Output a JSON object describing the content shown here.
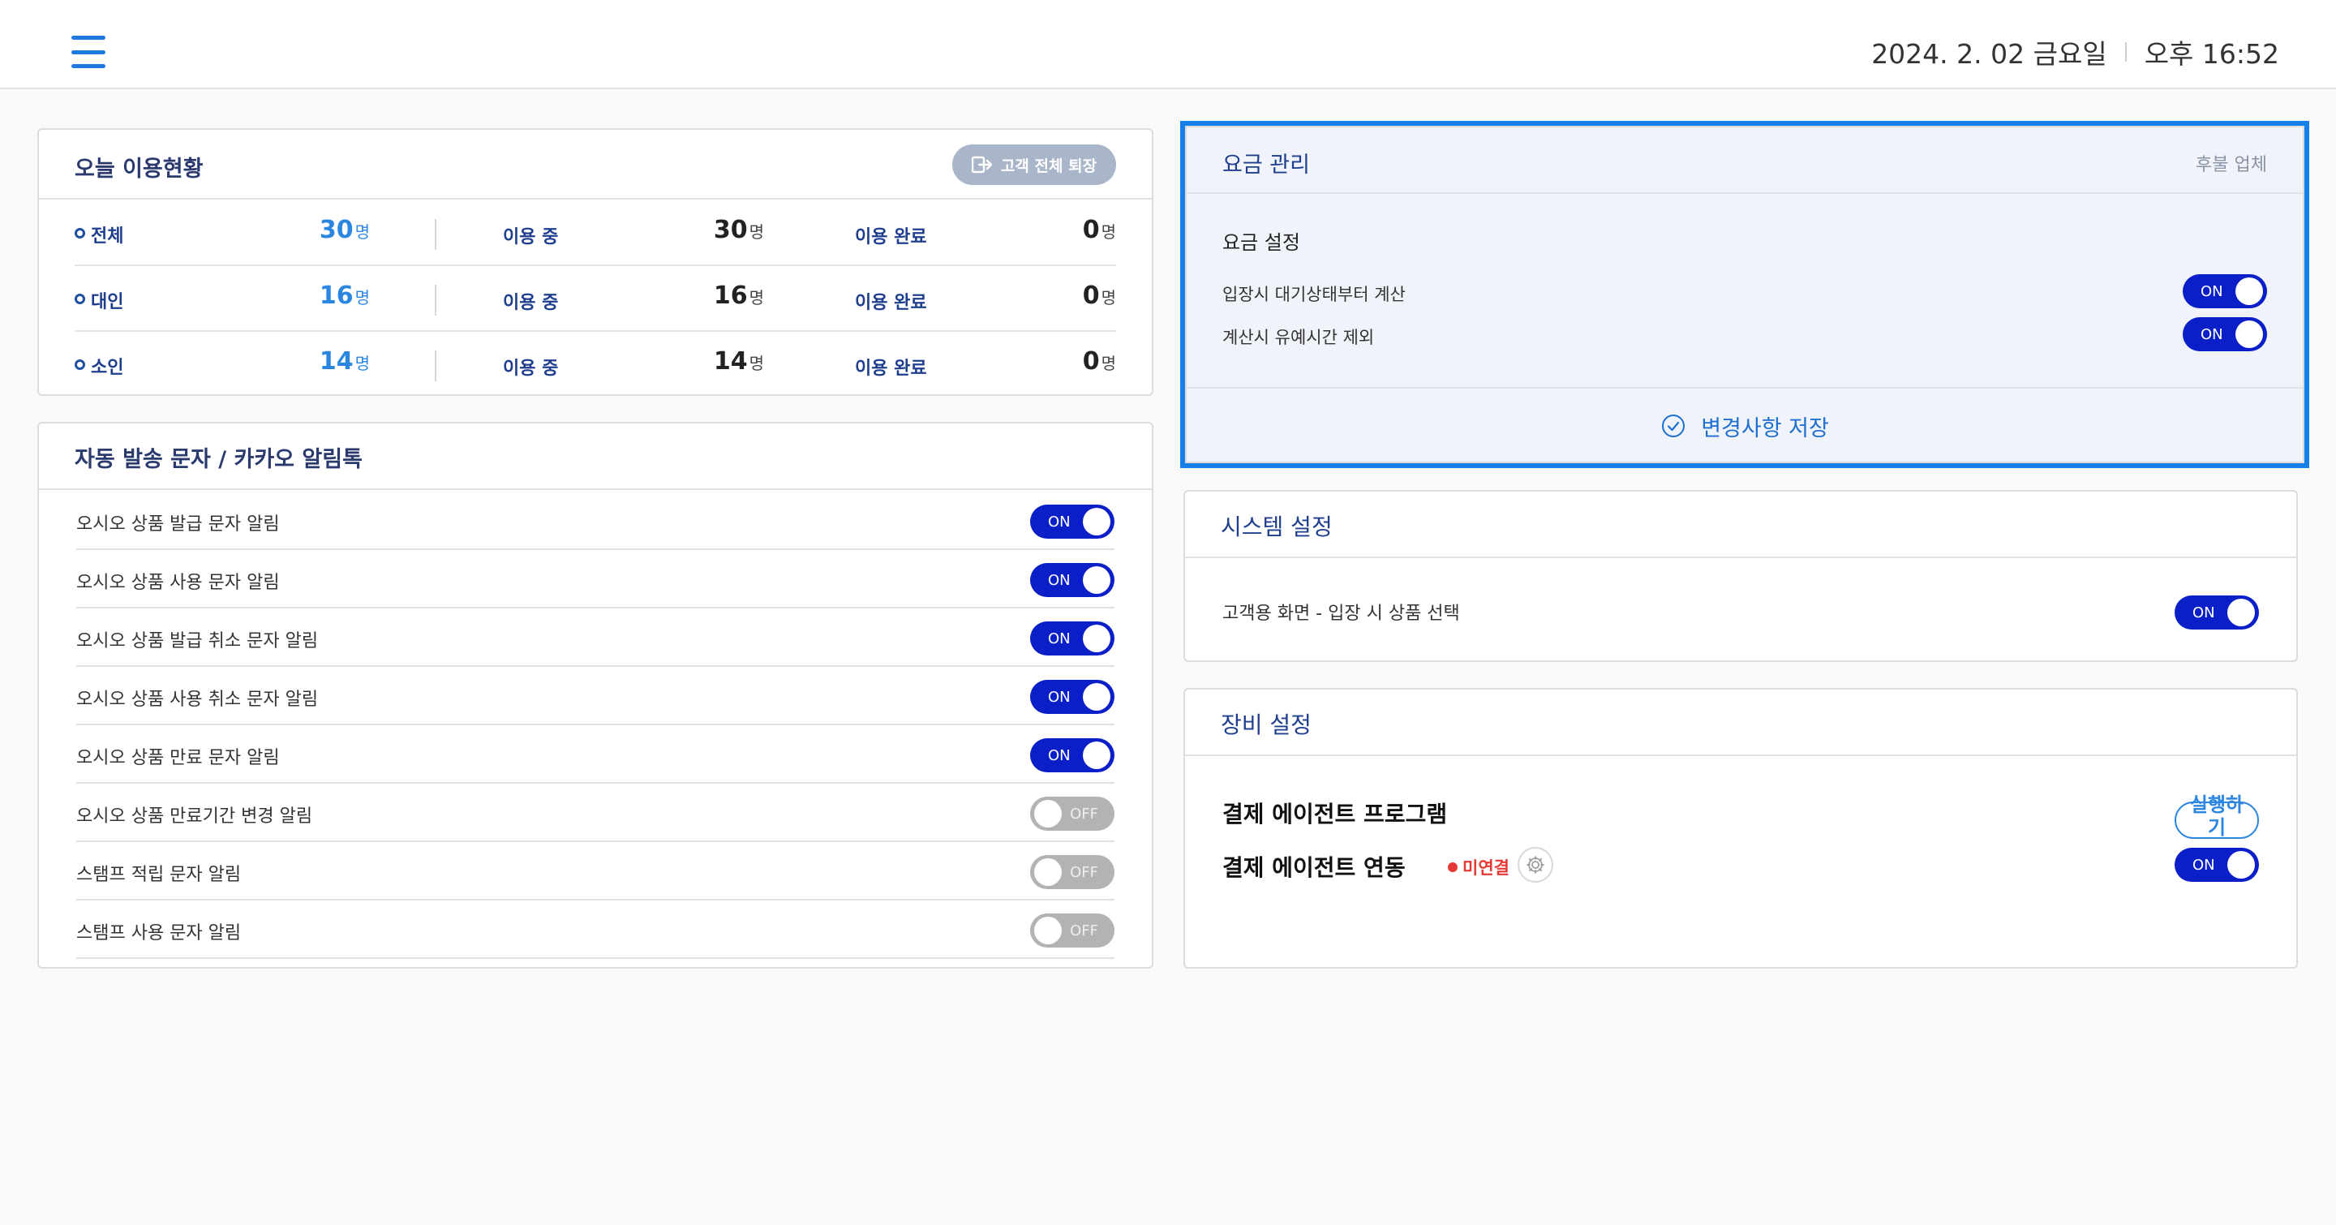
{
  "header": {
    "date": "2024. 2. 02 금요일",
    "time": "오후 16:52"
  },
  "usage": {
    "title": "오늘 이용현황",
    "exit_all_label": "고객 전체 퇴장",
    "in_use_label": "이용 중",
    "done_label": "이용 완료",
    "unit": "명",
    "rows": [
      {
        "category": "전체",
        "total": "30",
        "in_use": "30",
        "done": "0"
      },
      {
        "category": "대인",
        "total": "16",
        "in_use": "16",
        "done": "0"
      },
      {
        "category": "소인",
        "total": "14",
        "in_use": "14",
        "done": "0"
      }
    ]
  },
  "automsg": {
    "title": "자동 발송 문자 / 카카오 알림톡",
    "items": [
      {
        "label": "오시오 상품 발급 문자 알림",
        "state": "ON"
      },
      {
        "label": "오시오 상품 사용 문자 알림",
        "state": "ON"
      },
      {
        "label": "오시오 상품 발급 취소 문자 알림",
        "state": "ON"
      },
      {
        "label": "오시오 상품 사용 취소 문자 알림",
        "state": "ON"
      },
      {
        "label": "오시오 상품 만료 문자 알림",
        "state": "ON"
      },
      {
        "label": "오시오 상품 만료기간 변경 알림",
        "state": "OFF"
      },
      {
        "label": "스탬프 적립 문자 알림",
        "state": "OFF"
      },
      {
        "label": "스탬프 사용 문자 알림",
        "state": "OFF"
      }
    ]
  },
  "fee": {
    "title": "요금 관리",
    "tag": "후불 업체",
    "subtitle": "요금 설정",
    "items": [
      {
        "label": "입장시 대기상태부터 계산",
        "state": "ON"
      },
      {
        "label": "계산시 유예시간 제외",
        "state": "ON"
      }
    ],
    "save_label": "변경사항 저장"
  },
  "system": {
    "title": "시스템 설정",
    "items": [
      {
        "label": "고객용 화면 - 입장 시 상품 선택",
        "state": "ON"
      }
    ]
  },
  "device": {
    "title": "장비 설정",
    "agent_program_label": "결제 에이전트 프로그램",
    "run_label": "실행하기",
    "agent_link_label": "결제 에이전트 연동",
    "status_text": "미연결",
    "agent_link_state": "ON"
  },
  "colors": {
    "accent": "#1f7ae0",
    "toggle_on": "#0b1fc8",
    "toggle_off": "#b3b3b3",
    "highlight": "#1580e8",
    "error": "#e53935"
  }
}
